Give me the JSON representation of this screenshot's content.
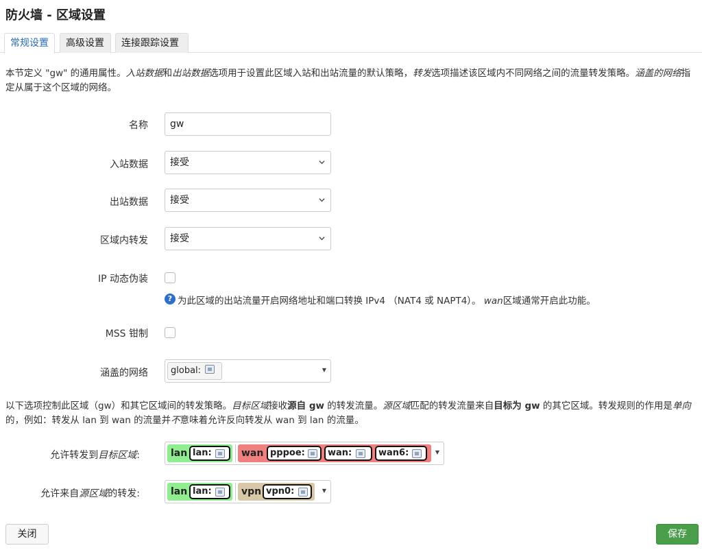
{
  "title": "防火墙 - 区域设置",
  "tabs": [
    {
      "label": "常规设置",
      "active": true
    },
    {
      "label": "高级设置",
      "active": false
    },
    {
      "label": "连接跟踪设置",
      "active": false
    }
  ],
  "intro": {
    "p1": "本节定义 \"gw\" 的通用属性。",
    "em1": "入站数据",
    "p2": "和",
    "em2": "出站数据",
    "p3": "选项用于设置此区域入站和出站流量的默认策略，",
    "em3": "转发",
    "p4": "选项描述该区域内不同网络之间的流量转发策略。",
    "em4": "涵盖的网络",
    "p5": "指定从属于这个区域的网络。"
  },
  "fields": {
    "name": {
      "label": "名称",
      "value": "gw"
    },
    "input": {
      "label": "入站数据",
      "value": "接受"
    },
    "output": {
      "label": "出站数据",
      "value": "接受"
    },
    "forward": {
      "label": "区域内转发",
      "value": "接受"
    },
    "masq": {
      "label": "IP 动态伪装",
      "checked": false,
      "help": "为此区域的出站流量开启网络地址和端口转换 IPv4 （NAT4 或 NAPT4）。",
      "help_em": "wan",
      "help_tail": "区域通常开启此功能。"
    },
    "mss": {
      "label": "MSS 钳制",
      "checked": false
    },
    "networks": {
      "label": "涵盖的网络",
      "value": "global:"
    }
  },
  "forward_desc": {
    "p1": "以下选项控制此区域（gw）和其它区域间的转发策略。",
    "em1": "目标区域",
    "p2": "接收",
    "b1": "源自 gw",
    "p3": " 的转发流量。",
    "em2": "源区域",
    "p4": "匹配的转发流量来自",
    "b2": "目标为 gw",
    "p5": " 的其它区域。转发规则的作用是",
    "em3": "单向",
    "p6": "的，例如：转发从 lan 到 wan 的流量并",
    "em4": "不",
    "p7": "意味着允许反向转发从 wan 到 lan 的流量。"
  },
  "dest": {
    "label_pre": "允许转发到",
    "label_em": "目标区域",
    "label_post": ":",
    "zones": [
      {
        "name": "lan",
        "color": "#90ee90",
        "chips": [
          "lan:"
        ]
      },
      {
        "name": "wan",
        "color": "#f08080",
        "chips": [
          "pppoe:",
          "wan:",
          "wan6:"
        ]
      }
    ]
  },
  "src": {
    "label_pre": "允许来自",
    "label_em": "源区域",
    "label_post": "的转发:",
    "zones": [
      {
        "name": "lan",
        "color": "#90ee90",
        "chips": [
          "lan:"
        ]
      },
      {
        "name": "vpn",
        "color": "#d8c8a8",
        "chips": [
          "vpn0:"
        ]
      }
    ]
  },
  "buttons": {
    "close": "关闭",
    "save": "保存"
  }
}
